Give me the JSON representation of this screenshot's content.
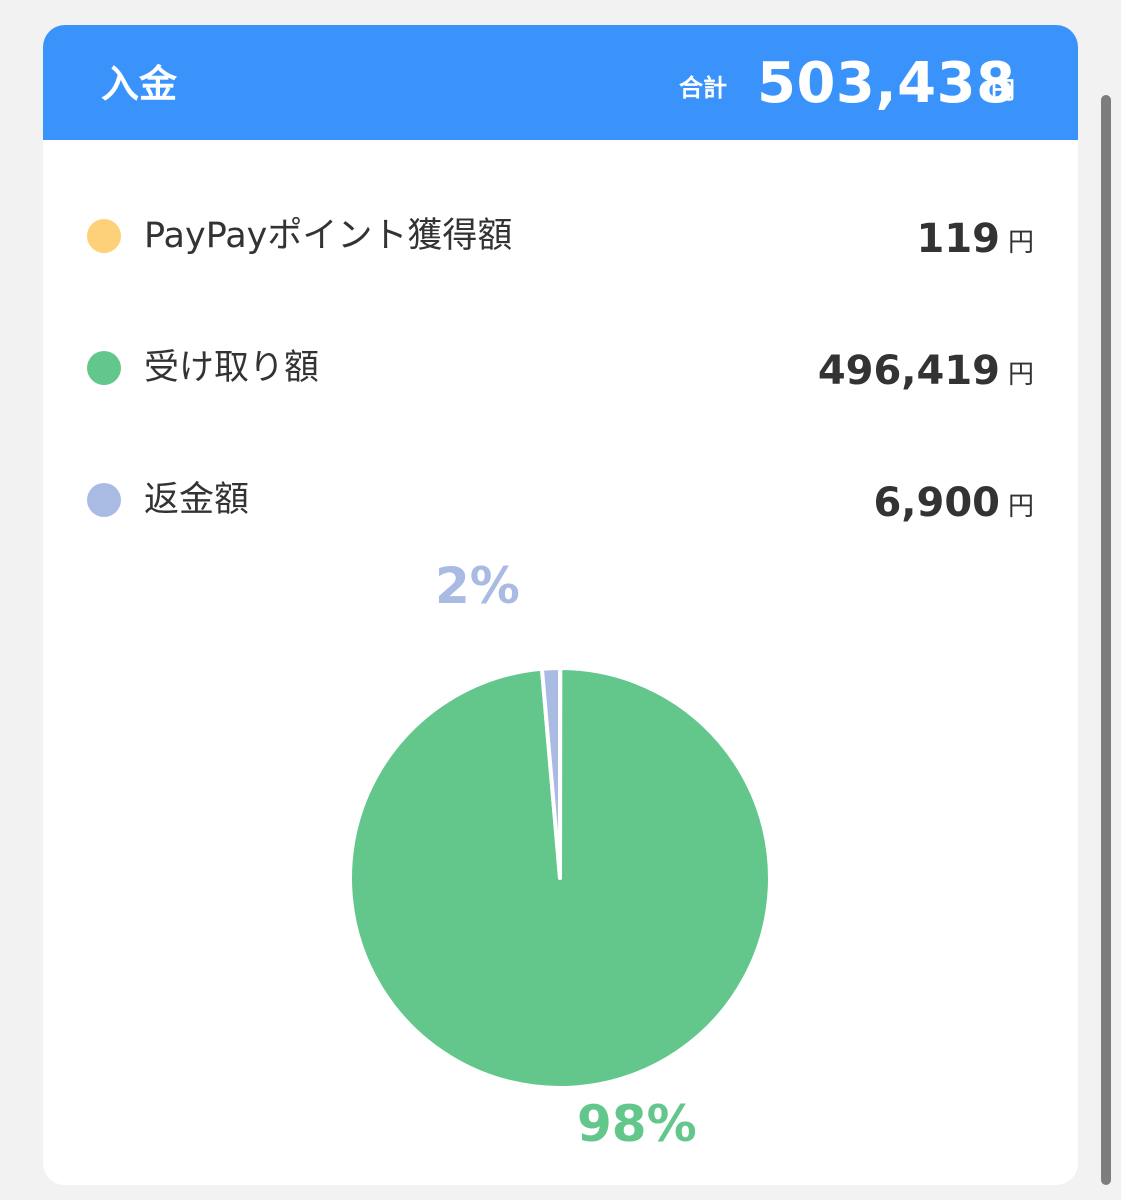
{
  "header": {
    "title": "入金",
    "total_label": "合計",
    "total_value": "503,438",
    "total_unit": "円"
  },
  "items": [
    {
      "label": "PayPayポイント獲得額",
      "value": "119",
      "unit": "円",
      "color": "#fdd07a"
    },
    {
      "label": "受け取り額",
      "value": "496,419",
      "unit": "円",
      "color": "#63c78c"
    },
    {
      "label": "返金額",
      "value": "6,900",
      "unit": "円",
      "color": "#a9bbe2"
    }
  ],
  "chart_data": {
    "type": "pie",
    "slices": [
      {
        "name": "PayPayポイント獲得額",
        "value": 119,
        "color": "#fdd07a"
      },
      {
        "name": "受け取り額",
        "value": 496419,
        "color": "#63c78c"
      },
      {
        "name": "返金額",
        "value": 6900,
        "color": "#a9bbe2"
      }
    ],
    "labels": [
      {
        "text": "2%",
        "color": "#a9bbe2"
      },
      {
        "text": "98%",
        "color": "#63c78c"
      }
    ]
  }
}
